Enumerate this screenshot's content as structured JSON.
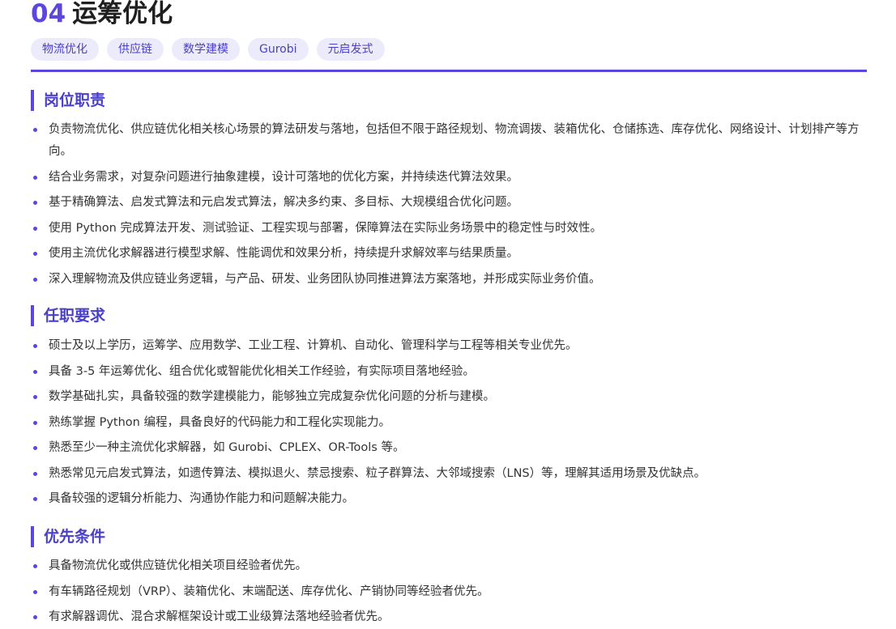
{
  "header": {
    "number": "04",
    "title": "运筹优化"
  },
  "tags": [
    "物流优化",
    "供应链",
    "数学建模",
    "Gurobi",
    "元启发式"
  ],
  "sections": {
    "duties": {
      "heading": "岗位职责",
      "items": [
        "负责物流优化、供应链优化相关核心场景的算法研发与落地，包括但不限于路径规划、物流调拨、装箱优化、仓储拣选、库存优化、网络设计、计划排产等方向。",
        "结合业务需求，对复杂问题进行抽象建模，设计可落地的优化方案，并持续迭代算法效果。",
        "基于精确算法、启发式算法和元启发式算法，解决多约束、多目标、大规模组合优化问题。",
        "使用 Python 完成算法开发、测试验证、工程实现与部署，保障算法在实际业务场景中的稳定性与时效性。",
        "使用主流优化求解器进行模型求解、性能调优和效果分析，持续提升求解效率与结果质量。",
        "深入理解物流及供应链业务逻辑，与产品、研发、业务团队协同推进算法方案落地，并形成实际业务价值。"
      ]
    },
    "requirements": {
      "heading": "任职要求",
      "items": [
        "硕士及以上学历，运筹学、应用数学、工业工程、计算机、自动化、管理科学与工程等相关专业优先。",
        "具备 3-5 年运筹优化、组合优化或智能优化相关工作经验，有实际项目落地经验。",
        "数学基础扎实，具备较强的数学建模能力，能够独立完成复杂优化问题的分析与建模。",
        "熟练掌握 Python 编程，具备良好的代码能力和工程化实现能力。",
        "熟悉至少一种主流优化求解器，如 Gurobi、CPLEX、OR-Tools 等。",
        "熟悉常见元启发式算法，如遗传算法、模拟退火、禁忌搜索、粒子群算法、大邻域搜索（LNS）等，理解其适用场景及优缺点。",
        "具备较强的逻辑分析能力、沟通协作能力和问题解决能力。"
      ]
    },
    "preferred": {
      "heading": "优先条件",
      "items": [
        "具备物流优化或供应链优化相关项目经验者优先。",
        "有车辆路径规划（VRP）、装箱优化、末端配送、库存优化、产销协同等经验者优先。",
        "有求解器调优、混合求解框架设计或工业级算法落地经验者优先。"
      ]
    }
  },
  "colors": {
    "accent": "#5b46e0",
    "tag_bg": "#ecebfb",
    "tag_text": "#4a3fc7",
    "body_text": "#333333"
  }
}
